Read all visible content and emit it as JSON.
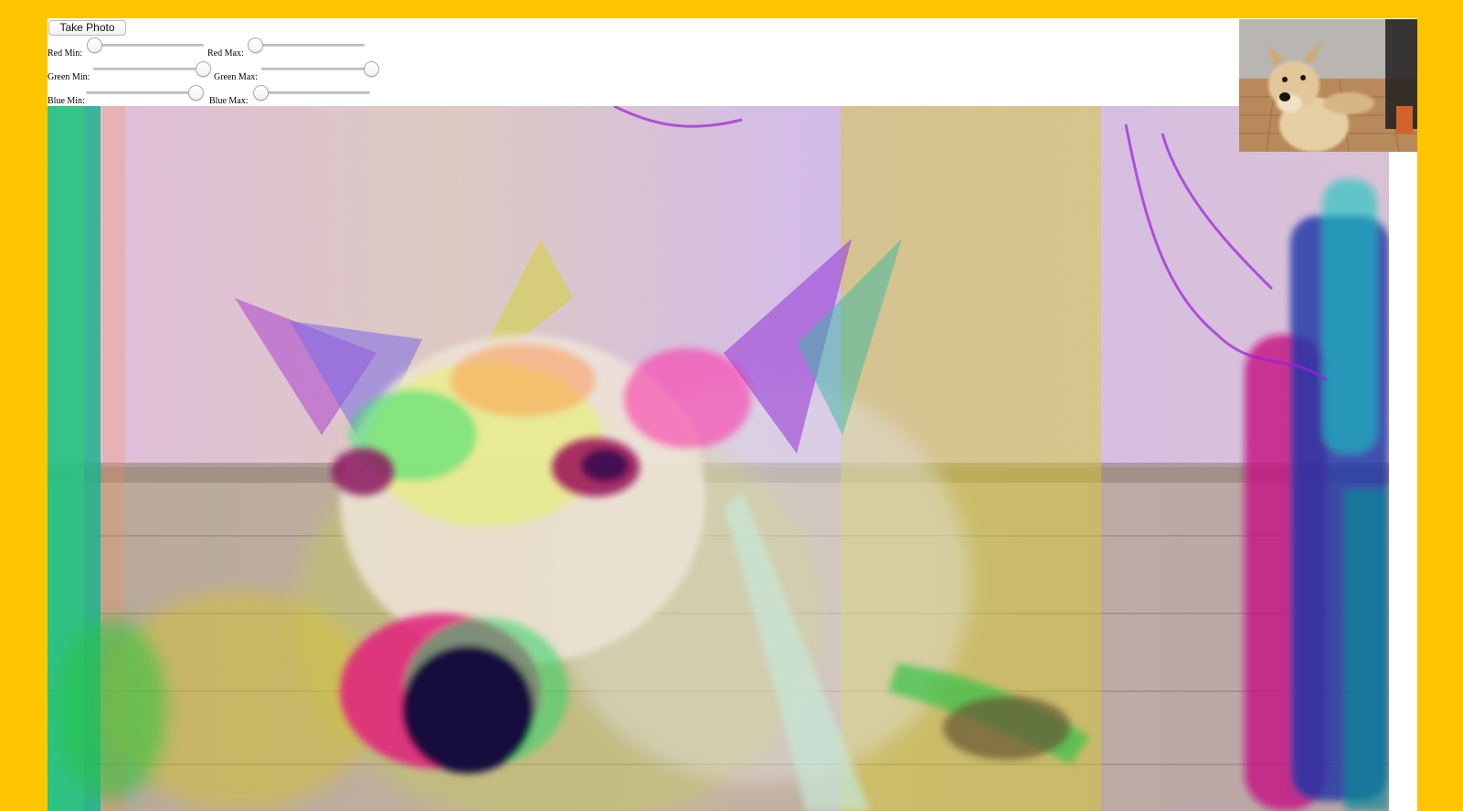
{
  "controls": {
    "take_photo_label": "Take Photo",
    "sliders": [
      {
        "id": "red-min",
        "label": "Red Min:",
        "value": 0
      },
      {
        "id": "red-max",
        "label": "Red Max:",
        "value": 0
      },
      {
        "id": "green-min",
        "label": "Green Min:",
        "value": 255
      },
      {
        "id": "green-max",
        "label": "Green Max:",
        "value": 255
      },
      {
        "id": "blue-min",
        "label": "Blue Min:",
        "value": 255
      },
      {
        "id": "blue-max",
        "label": "Blue Max:",
        "value": 0
      }
    ],
    "slider_range": [
      0,
      255
    ]
  },
  "colors": {
    "page_background": "#FFC600",
    "content_background": "#FFFFFF"
  }
}
